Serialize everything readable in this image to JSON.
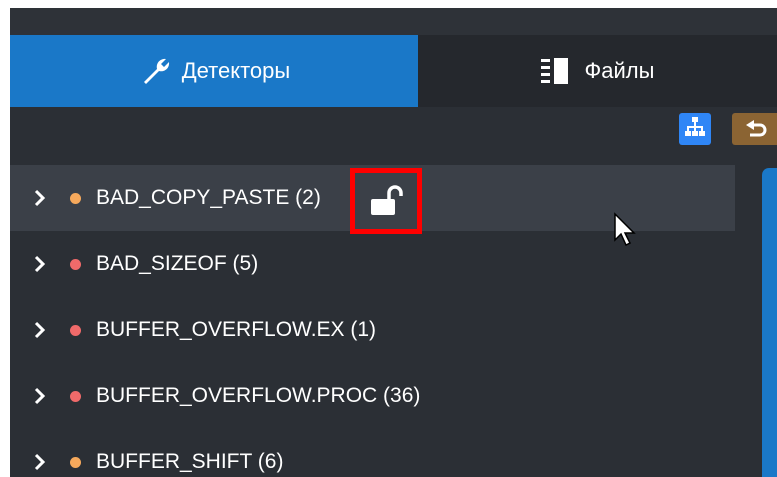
{
  "tabs": [
    {
      "label": "Детекторы",
      "icon": "wrench-icon",
      "active": true
    },
    {
      "label": "Файлы",
      "icon": "file-list-icon",
      "active": false
    }
  ],
  "toolbar": {
    "tree_icon": "hierarchy-icon",
    "undo_icon": "undo-icon"
  },
  "detectors": [
    {
      "label": "BAD_COPY_PASTE (2)",
      "severity_color": "#f6a95c",
      "selected": true,
      "lock_icon": "unlock-icon"
    },
    {
      "label": "BAD_SIZEOF (5)",
      "severity_color": "#f06a6a",
      "selected": false
    },
    {
      "label": "BUFFER_OVERFLOW.EX (1)",
      "severity_color": "#f06a6a",
      "selected": false
    },
    {
      "label": "BUFFER_OVERFLOW.PROC (36)",
      "severity_color": "#f06a6a",
      "selected": false
    },
    {
      "label": "BUFFER_SHIFT (6)",
      "severity_color": "#f6a95c",
      "selected": false
    }
  ],
  "colors": {
    "accent": "#1a78c8",
    "panel_bg": "#2b2f35",
    "highlight_border": "#ff0000"
  }
}
